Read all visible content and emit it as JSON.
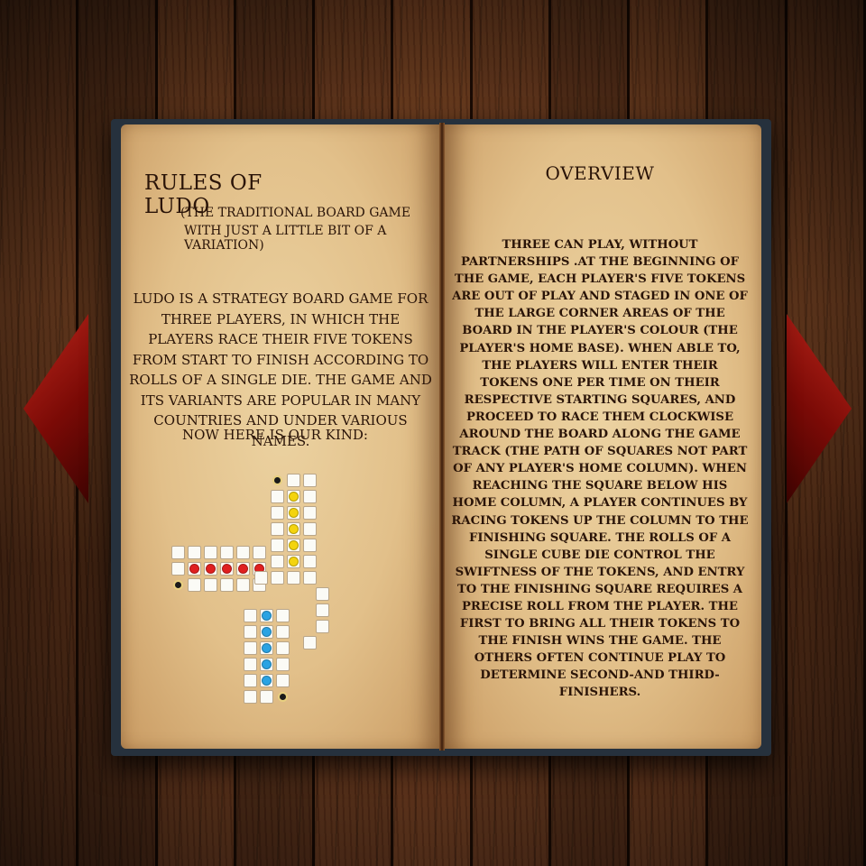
{
  "left_page": {
    "title": "Rules of Ludo",
    "subtitle_line1": "(The traditional board game",
    "subtitle_line2": "with just a little bit of a variation)",
    "intro": "Ludo is a strategy board game for three players, in which the players race their five tokens from start to finish according to rolls of a single die. The game and its variants are popular in many countries and under various names.",
    "our_kind": "Now here is our kind:"
  },
  "right_page": {
    "title": "Overview",
    "body": "Three can play, without partnerships .At the beginning of the game, each player's five tokens are out of play and staged in one of the large corner areas of the board in the player's colour (the player's home base). When able to, the players will enter their tokens one per time on their respective starting squares, and proceed to race them clockwise around the board along the game track (the path of squares not part of any player's home column). When reaching the square below his home column, a player continues by racing tokens up the column to the finishing square. The rolls of a single cube die control the swiftness of the tokens, and entry to the finishing square requires a precise roll from the player. The first to bring all their tokens to the finish wins the game. The others often continue play to determine second-and third-finishers."
  },
  "board": {
    "players": [
      "yellow",
      "red",
      "blue"
    ],
    "tokens_per_player": 5
  },
  "colors": {
    "yellow": "#f4d40e",
    "red": "#e02020",
    "blue": "#2aa3e3",
    "page": "#e2c08a",
    "arrow": "#a0150d"
  },
  "icons": [
    "previous-page-arrow-icon",
    "next-page-arrow-icon"
  ]
}
